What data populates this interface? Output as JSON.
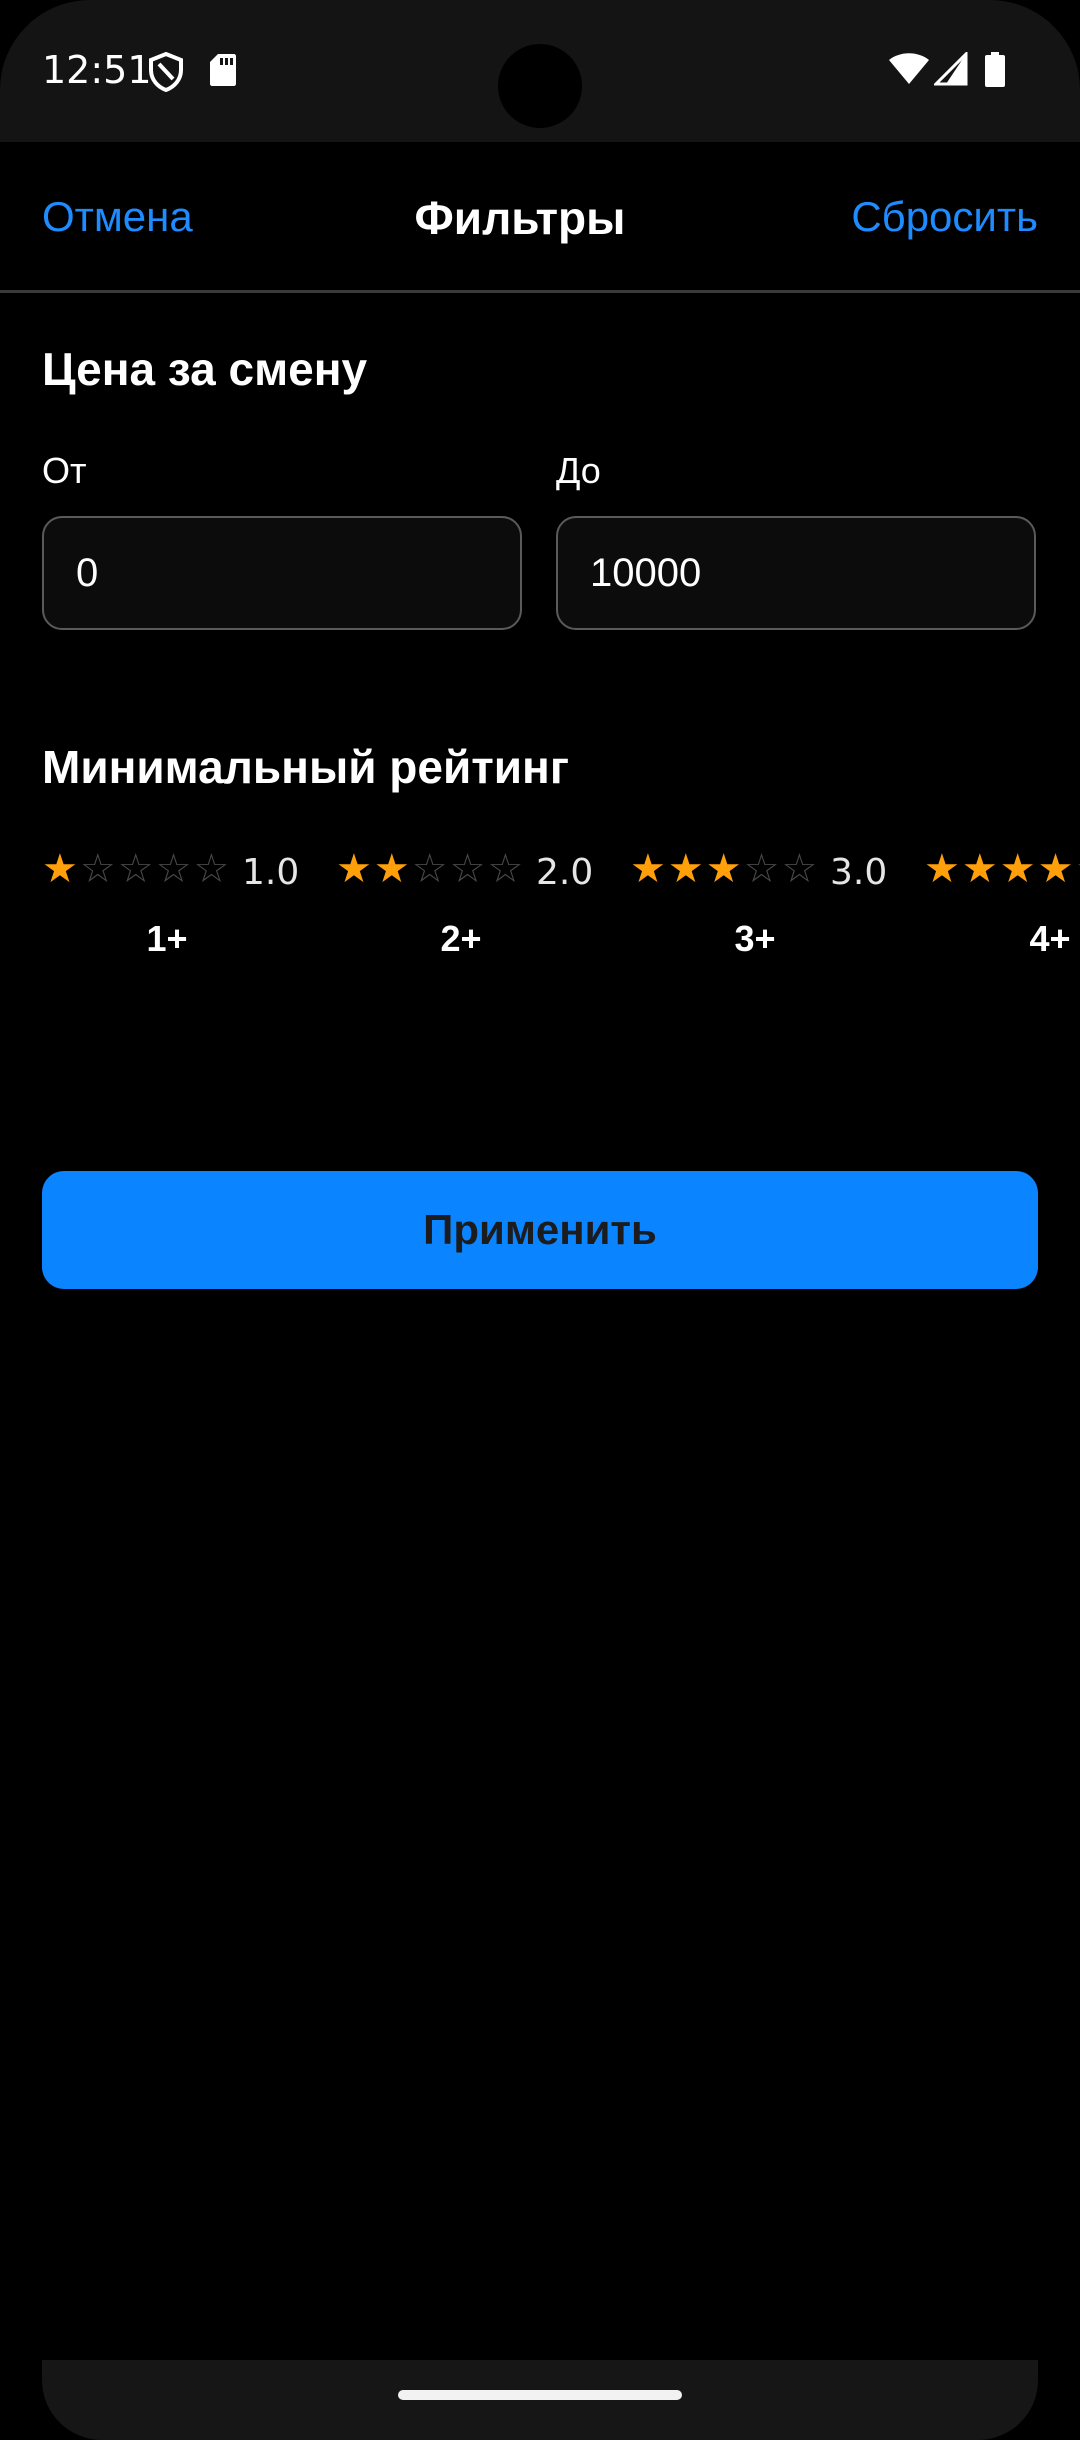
{
  "status_bar": {
    "time": "12:51",
    "icons": [
      "shield-icon",
      "sd-card-icon",
      "wifi-icon",
      "signal-icon",
      "battery-icon"
    ]
  },
  "nav": {
    "cancel": "Отмена",
    "title": "Фильтры",
    "reset": "Сбросить"
  },
  "price": {
    "title": "Цена за смену",
    "from_label": "От",
    "from_value": "0",
    "to_label": "До",
    "to_value": "10000"
  },
  "rating": {
    "title": "Минимальный рейтинг",
    "options": [
      {
        "stars": 1,
        "value": "1.0",
        "label": "1+"
      },
      {
        "stars": 2,
        "value": "2.0",
        "label": "2+"
      },
      {
        "stars": 3,
        "value": "3.0",
        "label": "3+"
      },
      {
        "stars": 4,
        "value": "",
        "label": "4+"
      }
    ]
  },
  "apply_label": "Применить",
  "colors": {
    "accent": "#0a84ff",
    "link": "#1e8cff",
    "star_active": "#ff9f0a",
    "star_inactive": "#48484a",
    "background": "#000000"
  }
}
